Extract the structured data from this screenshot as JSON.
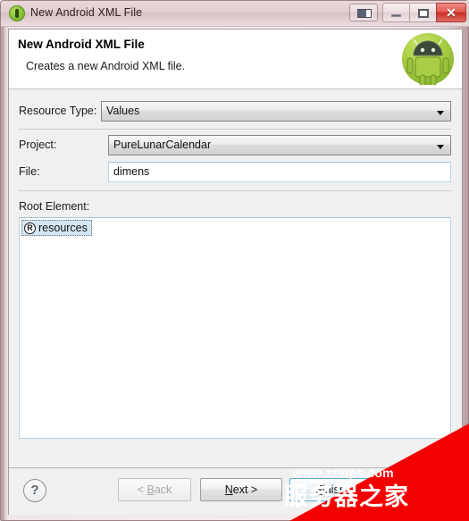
{
  "window": {
    "title": "New Android XML File",
    "title_icon": "android-icon",
    "caption_buttons": {
      "help_layout": "layout-toggle-icon",
      "minimize": "minimize-icon",
      "maximize": "maximize-icon",
      "close": "✕"
    }
  },
  "header": {
    "title": "New Android XML File",
    "subtitle": "Creates a new Android XML file.",
    "logo": "android-robot-logo"
  },
  "form": {
    "resource_type": {
      "label": "Resource Type:",
      "value": "Values"
    },
    "project": {
      "label": "Project:",
      "value": "PureLunarCalendar"
    },
    "file": {
      "label": "File:",
      "value": "dimens",
      "placeholder": ""
    },
    "root_element": {
      "label": "Root Element:",
      "items": [
        {
          "icon": "R",
          "label": "resources",
          "selected": true
        }
      ]
    }
  },
  "buttons": {
    "help": "?",
    "back": {
      "pre": "< ",
      "mnemonic": "B",
      "post": "ack",
      "enabled": false
    },
    "next": {
      "pre": "",
      "mnemonic": "N",
      "post": "ext >",
      "enabled": true
    },
    "finish": {
      "pre": "",
      "mnemonic": "F",
      "post": "inish",
      "enabled": true,
      "default": true
    }
  },
  "watermark": {
    "url": "www.zzvips.com",
    "text": "服务器之家",
    "color": "#f50000"
  }
}
